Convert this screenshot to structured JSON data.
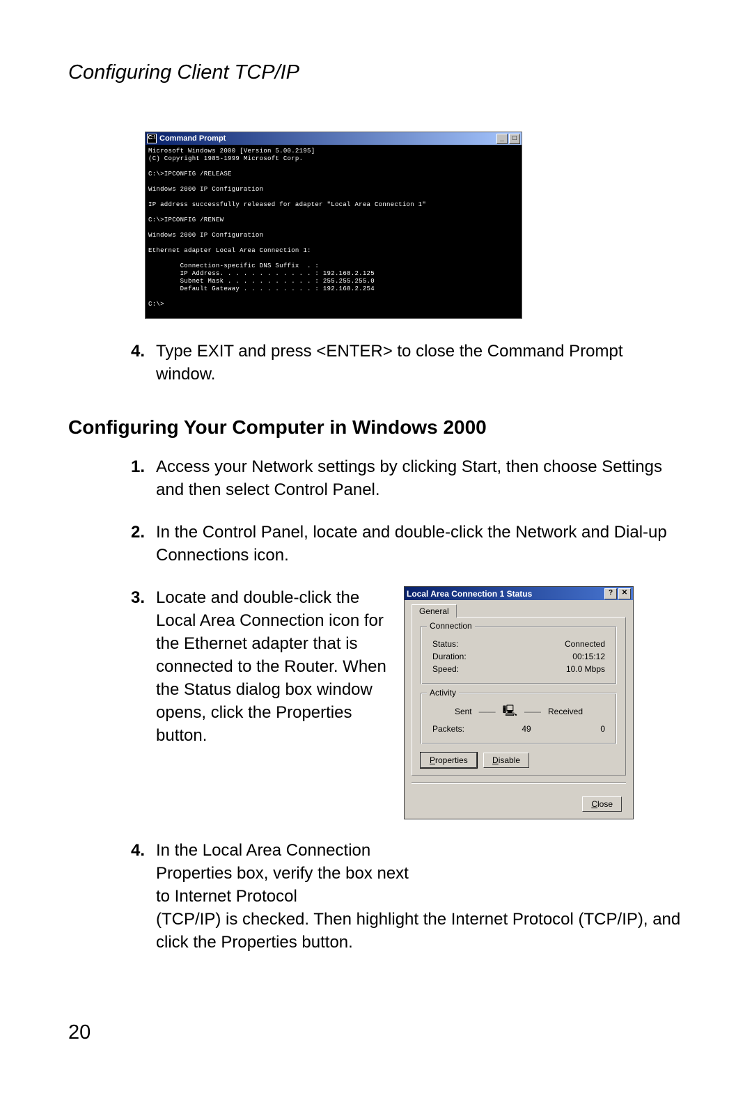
{
  "header": "Configuring Client TCP/IP",
  "page_number": "20",
  "cmd": {
    "title": "Command Prompt",
    "btn_min": "_",
    "btn_max": "□",
    "lines": {
      "l01": "Microsoft Windows 2000 [Version 5.00.2195]",
      "l02": "(C) Copyright 1985-1999 Microsoft Corp.",
      "l03": "",
      "l04": "C:\\>IPCONFIG /RELEASE",
      "l05": "",
      "l06": "Windows 2000 IP Configuration",
      "l07": "",
      "l08": "IP address successfully released for adapter \"Local Area Connection 1\"",
      "l09": "",
      "l10": "C:\\>IPCONFIG /RENEW",
      "l11": "",
      "l12": "Windows 2000 IP Configuration",
      "l13": "",
      "l14": "Ethernet adapter Local Area Connection 1:",
      "l15": "",
      "l16": "        Connection-specific DNS Suffix  . :",
      "l17": "        IP Address. . . . . . . . . . . . : 192.168.2.125",
      "l18": "        Subnet Mask . . . . . . . . . . . : 255.255.255.0",
      "l19": "        Default Gateway . . . . . . . . . : 192.168.2.254",
      "l20": "",
      "l21": "C:\\>"
    }
  },
  "step_top4": {
    "num": "4.",
    "text": "Type EXIT and press <ENTER> to close the Command Prompt window."
  },
  "section_heading": "Configuring Your Computer in Windows 2000",
  "steps": {
    "s1": {
      "num": "1.",
      "text": "Access your Network settings by clicking Start, then choose Settings and then select Control Panel."
    },
    "s2": {
      "num": "2.",
      "text": "In the Control Panel, locate and double-click the Network and Dial-up Connections icon."
    },
    "s3": {
      "num": "3.",
      "text": "Locate and double-click the Local Area Connection icon for the Ethernet adapter that is connected to the Router. When the Status dialog box window opens, click the Properties button."
    },
    "s4": {
      "num": "4.",
      "text_top": "In the Local Area Connection Properties box, verify the box next to Internet Protocol",
      "text_full": "(TCP/IP) is checked. Then highlight the Internet Protocol (TCP/IP), and click the Properties button."
    }
  },
  "lan": {
    "title": "Local Area Connection 1 Status",
    "btn_help": "?",
    "btn_close_x": "✕",
    "tab": "General",
    "group_connection": "Connection",
    "status_label": "Status:",
    "status_value": "Connected",
    "duration_label": "Duration:",
    "duration_value": "00:15:12",
    "speed_label": "Speed:",
    "speed_value": "10.0 Mbps",
    "group_activity": "Activity",
    "sent_label": "Sent",
    "received_label": "Received",
    "packets_label": "Packets:",
    "packets_sent": "49",
    "packets_received": "0",
    "btn_properties": "Properties",
    "btn_disable": "Disable",
    "btn_close": "Close"
  }
}
